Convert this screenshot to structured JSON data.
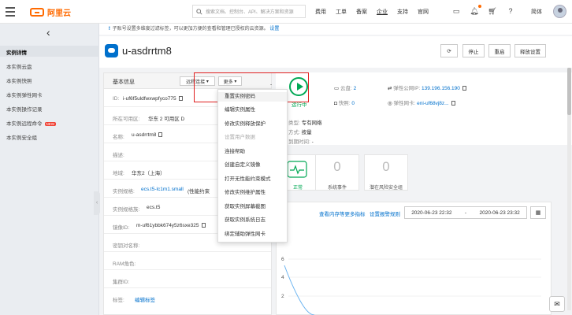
{
  "topbar": {
    "logo_text": "阿里云",
    "search_placeholder": "搜索文档、控制台、API、解决方案和资源",
    "nav": [
      "费用",
      "工单",
      "备案",
      "企业",
      "支持",
      "官网"
    ],
    "lang": "简体"
  },
  "sidebar": {
    "items": [
      {
        "label": "实例详情",
        "active": true
      },
      {
        "label": "本实例云盘"
      },
      {
        "label": "本实例快照"
      },
      {
        "label": "本实例弹性网卡"
      },
      {
        "label": "本实例操作记录"
      },
      {
        "label": "本实例远程命令",
        "badge": "NEW"
      },
      {
        "label": "本实例安全组"
      }
    ]
  },
  "notice": {
    "text": "子账号设置多维度过滤标签，可以更加方便的查看和管理已授权的云资源。",
    "link": "设置"
  },
  "instance": {
    "name": "u-asdrrtm8",
    "buttons": {
      "refresh": "⟳",
      "stop": "停止",
      "restart": "重启",
      "release": "释放设置"
    }
  },
  "basic_info": {
    "title": "基本信息",
    "remote_btn": "远程连接",
    "more_btn": "更多",
    "rows": [
      {
        "key": "ID:",
        "value": "i-uf6f5uldfwxwpfyco775"
      },
      {
        "key": "所在可用区:",
        "value": "华东 2 可用区 D"
      },
      {
        "key": "名称:",
        "value": "u-asdrrtm8"
      },
      {
        "key": "描述:",
        "value": ""
      },
      {
        "key": "地域:",
        "value": "华东2（上海）"
      },
      {
        "key": "实例规格:",
        "value": "ecs.t5-lc1m1.small",
        "suffix": "(性能约束"
      },
      {
        "key": "实例规格族:",
        "value": "ecs.t5"
      },
      {
        "key": "镜像ID:",
        "value": "m-uf61ybbk674y5z6sxe325"
      },
      {
        "key": "密钥对名称:",
        "value": ""
      },
      {
        "key": "RAM角色:",
        "value": ""
      },
      {
        "key": "集群ID:",
        "value": ""
      },
      {
        "key": "标签:",
        "value": "编辑标签"
      }
    ]
  },
  "dropdown": {
    "items": [
      {
        "label": "重置实例密码",
        "highlighted": true
      },
      {
        "label": "编辑实例属性"
      },
      {
        "label": "修改实例释放保护"
      },
      {
        "label": "设置用户数据",
        "disabled": true
      },
      {
        "label": "连接帮助"
      },
      {
        "label": "创建自定义镜像"
      },
      {
        "label": "打开无性能约束模式"
      },
      {
        "label": "修改实例维护属性"
      },
      {
        "label": "获取实例屏幕截图"
      },
      {
        "label": "获取实例系统日志"
      },
      {
        "label": "绑定辅助弹性网卡"
      }
    ]
  },
  "status": {
    "running_label": "运行中",
    "disk_label": "云盘:",
    "disk_value": "2",
    "snapshot_label": "快照:",
    "snapshot_value": "0",
    "eip_label": "弹性公网IP:",
    "eip_value": "139.196.156.190",
    "eni_label": "弹性网卡:",
    "eni_value": "eni-uf68vj8z...",
    "network_label": "类型:",
    "network_value": "专有网络",
    "billing_label": "方式:",
    "billing_value": "按量",
    "expire_label": "到期时间:",
    "expire_value": "-",
    "dash": "-"
  },
  "monitor": {
    "ok_label": "正常",
    "events_value": "0",
    "events_label": "系统事件",
    "risk_value": "0",
    "risk_label": "潜在风险安全组"
  },
  "chart_controls": {
    "more_link": "查看内存等更多指标",
    "alarm_link": "设置报警规则",
    "start": "2020-06-23 22:32",
    "sep": "-",
    "end": "2020-06-23 23:32"
  },
  "chart_data": {
    "type": "line",
    "title": "",
    "xlabel": "",
    "ylabel": "",
    "y_ticks": [
      "6",
      "4",
      "2"
    ],
    "ylim": [
      0,
      7
    ]
  }
}
